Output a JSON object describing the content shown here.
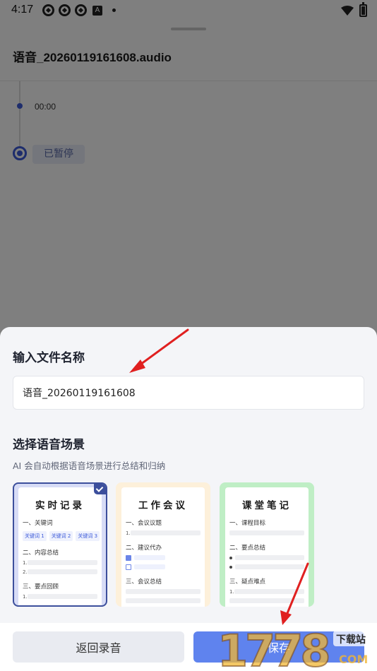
{
  "status_bar": {
    "time": "4:17",
    "notif_letter": "A"
  },
  "background": {
    "file_title": "语音_20260119161608.audio",
    "timestamp": "00:00",
    "state": "已暂停"
  },
  "sheet": {
    "name_label": "输入文件名称",
    "name_value": "语音_20260119161608",
    "scene_label": "选择语音场景",
    "scene_desc": "AI 会自动根据语音场景进行总结和归纳",
    "cards": [
      {
        "title": "实时记录",
        "selected": true,
        "sec1": "一、关键词",
        "keywords": [
          "关键词 1",
          "关键词 2",
          "关键词 3"
        ],
        "sec2": "二、内容总结",
        "sec3": "三、要点回顾",
        "num1": "1.",
        "num2": "2."
      },
      {
        "title": "工作会议",
        "selected": false,
        "sec1": "一、会议议题",
        "sec2": "二、建议代办",
        "sec3": "三、会议总结",
        "num1": "1."
      },
      {
        "title": "课堂笔记",
        "selected": false,
        "sec1": "一、课程目标",
        "sec2": "二、要点总结",
        "sec3": "三、疑点难点",
        "num1": "1."
      }
    ],
    "back_button": "返回录音",
    "save_button": "保存"
  },
  "watermark": {
    "text": "1778",
    "site": "下载站",
    "domain": "COM"
  },
  "colors": {
    "accent": "#5f83ee",
    "card_selected_border": "#3c4f9c",
    "arrow": "#e02020"
  }
}
